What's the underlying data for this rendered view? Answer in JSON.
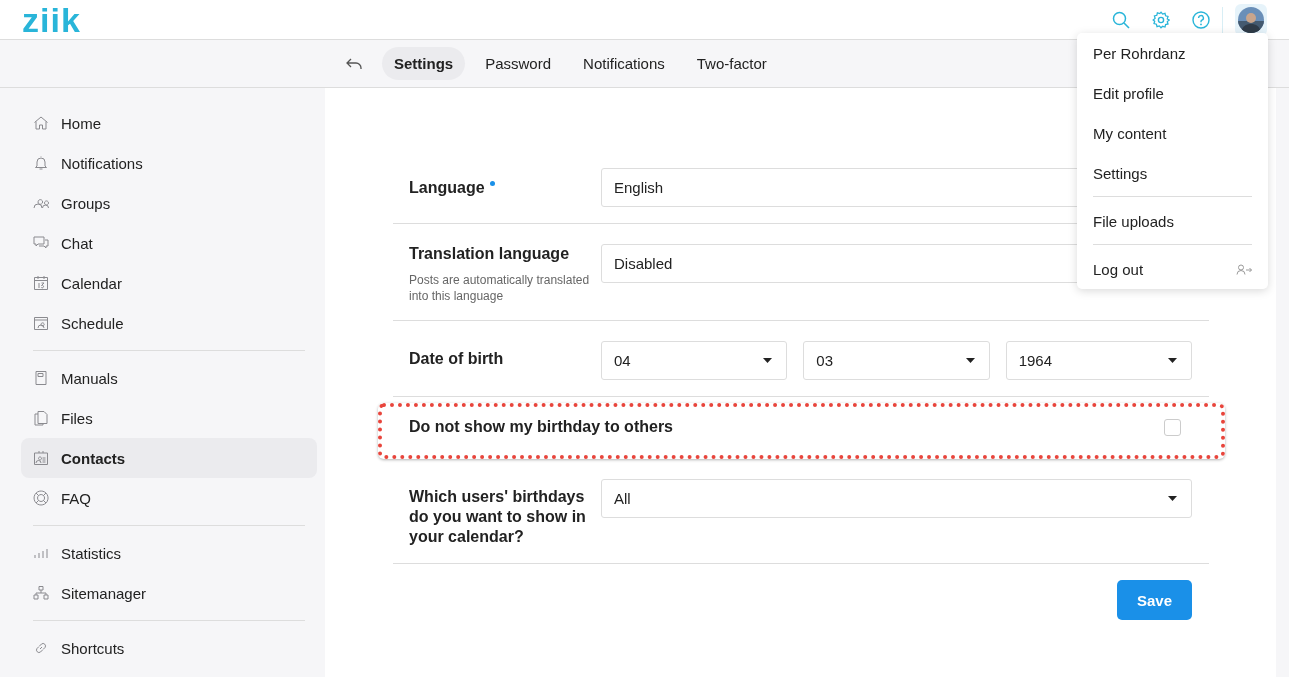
{
  "logo": "ziik",
  "subnav": {
    "tabs": [
      {
        "label": "Settings",
        "selected": true
      },
      {
        "label": "Password",
        "selected": false
      },
      {
        "label": "Notifications",
        "selected": false
      },
      {
        "label": "Two-factor",
        "selected": false
      }
    ]
  },
  "sidebar": {
    "groups": [
      {
        "items": [
          {
            "label": "Home",
            "selected": false
          },
          {
            "label": "Notifications",
            "selected": false
          },
          {
            "label": "Groups",
            "selected": false
          },
          {
            "label": "Chat",
            "selected": false
          },
          {
            "label": "Calendar",
            "selected": false
          },
          {
            "label": "Schedule",
            "selected": false
          }
        ]
      },
      {
        "items": [
          {
            "label": "Manuals",
            "selected": false
          },
          {
            "label": "Files",
            "selected": false
          },
          {
            "label": "Contacts",
            "selected": true
          },
          {
            "label": "FAQ",
            "selected": false
          }
        ]
      },
      {
        "items": [
          {
            "label": "Statistics",
            "selected": false
          },
          {
            "label": "Sitemanager",
            "selected": false
          }
        ]
      },
      {
        "items": [
          {
            "label": "Shortcuts",
            "selected": false
          }
        ]
      }
    ]
  },
  "form": {
    "rows": [
      {
        "kind": "select",
        "label": "Language",
        "required": true,
        "values": [
          "English"
        ]
      },
      {
        "kind": "select",
        "label": "Translation language",
        "required": false,
        "help": "Posts are automatically translated into this language",
        "values": [
          "Disabled"
        ]
      },
      {
        "kind": "date",
        "label": "Date of birth",
        "required": false,
        "values": [
          "04",
          "03",
          "1964"
        ]
      },
      {
        "kind": "checkbox",
        "label": "Do not show my birthday to others",
        "required": false,
        "checked": false,
        "highlighted": true
      },
      {
        "kind": "select",
        "label": "Which users' birthdays do you want to show in your calendar?",
        "required": false,
        "values": [
          "All"
        ]
      }
    ],
    "save": "Save"
  },
  "user_menu": {
    "groups": [
      [
        "Per Rohrdanz",
        "Edit profile",
        "My content",
        "Settings"
      ],
      [
        "File uploads"
      ],
      [
        "Log out"
      ]
    ]
  }
}
